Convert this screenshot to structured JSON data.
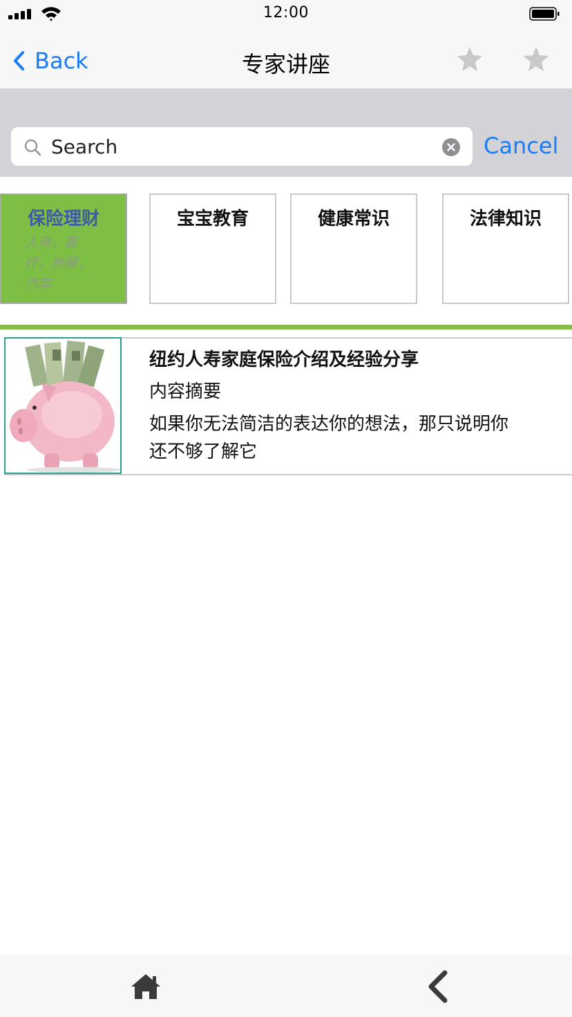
{
  "status": {
    "time": "12:00"
  },
  "nav": {
    "back_label": "Back",
    "title": "专家讲座"
  },
  "search": {
    "placeholder": "Search",
    "cancel_label": "Cancel"
  },
  "categories": [
    {
      "title": "保险理财",
      "subtitle": "人寿，医疗，房屋，汽车",
      "active": true
    },
    {
      "title": "宝宝教育"
    },
    {
      "title": "健康常识"
    },
    {
      "title": "法律知识"
    }
  ],
  "lectures": [
    {
      "title": "纽约人寿家庭保险介绍及经验分享",
      "summary_label": "内容摘要",
      "summary": "如果你无法简洁的表达你的想法，那只说明你还不够了解它",
      "thumbnail_icon": "piggy-bank-icon"
    }
  ],
  "bottom": {
    "home_icon": "home-icon",
    "back_icon": "chevron-left-icon"
  },
  "colors": {
    "accent": "#1a7cf5",
    "active_tile": "#7dbf45",
    "active_tile_text": "#3f5aa8",
    "divider": "#86bd4a",
    "thumb_border": "#2a9d8f"
  }
}
